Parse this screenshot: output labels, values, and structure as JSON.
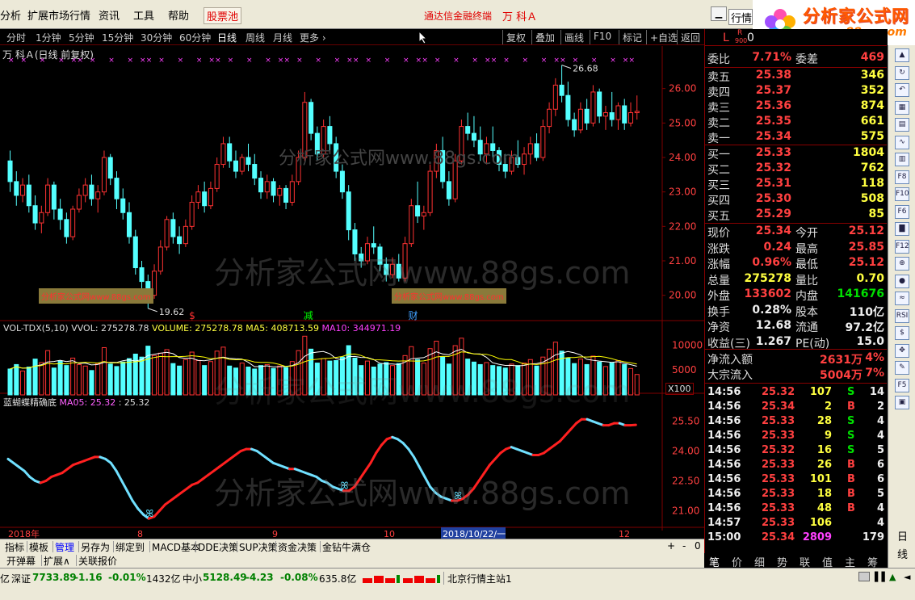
{
  "menubar": {
    "items": [
      "分析",
      "扩展市场行情",
      "资讯",
      "工具",
      "帮助"
    ],
    "stock_pool": "股票池",
    "app_title": "通达信金融终端",
    "stock_title": "万 科Ａ",
    "quote_select": "行情"
  },
  "logo": {
    "name": "分析家公式网",
    "url": "www.88gs.com"
  },
  "periods": {
    "items": [
      "分时",
      "1分钟",
      "5分钟",
      "15分钟",
      "30分钟",
      "60分钟",
      "日线",
      "周线",
      "月线",
      "更多 ›"
    ],
    "active": "日线"
  },
  "tools": [
    "复权",
    "叠加",
    "画线",
    "F10",
    "标记",
    "+自选",
    "返回"
  ],
  "chart": {
    "stock_line": "万 科Ａ(日线 前复权)",
    "price_ticks": [
      "26.00",
      "25.00",
      "24.00",
      "23.00",
      "22.00",
      "21.00",
      "20.00"
    ],
    "high_label": "26.68",
    "low_label": "19.62",
    "event_marks": [
      "$",
      "减",
      "财"
    ],
    "tag_left": "分析家公式网www.88gs.com",
    "tag_mid": "分析家公式网www.88gs.com",
    "vol_line": {
      "name": "VOL-TDX(5,10)",
      "vvol": "VVOL: 275278.78",
      "volume": "VOLUME: 275278.78",
      "ma5": "MA5: 408713.59",
      "ma10": "MA10: 344971.19"
    },
    "vol_ticks": [
      "10000",
      "5000"
    ],
    "vol_unit": "X100",
    "ind_line": {
      "name": "蓝蝴蝶精确底",
      "ma05": "MA05: 25.32",
      "val": ": 25.32"
    },
    "ind_ticks": [
      "25.50",
      "24.00",
      "22.50",
      "21.00"
    ],
    "date_axis": [
      "2018年",
      "8",
      "9",
      "10",
      "2018/10/22/一",
      "12"
    ],
    "watermark_text": "分析家公式网www.88gs.com",
    "watermark_small": "分析家公式网www.88gs.com"
  },
  "colors": {
    "up": "#ff3232",
    "down": "#54ffff",
    "ma5": "#ffffff",
    "ma10": "#ffff00",
    "grid": "#800000"
  },
  "chart_data": {
    "type": "candlestick",
    "ylim": [
      19.5,
      27.0
    ],
    "candles": [
      [
        23.9,
        24.2,
        23.0,
        23.3
      ],
      [
        23.3,
        23.6,
        22.6,
        22.9
      ],
      [
        22.9,
        23.4,
        22.7,
        23.2
      ],
      [
        23.2,
        23.5,
        22.4,
        22.6
      ],
      [
        22.6,
        22.9,
        21.9,
        22.1
      ],
      [
        22.1,
        22.6,
        21.8,
        22.4
      ],
      [
        22.4,
        23.4,
        22.3,
        23.2
      ],
      [
        23.2,
        23.3,
        22.2,
        22.5
      ],
      [
        22.5,
        22.8,
        21.9,
        22.2
      ],
      [
        22.2,
        22.4,
        21.5,
        21.7
      ],
      [
        21.7,
        22.6,
        21.6,
        22.5
      ],
      [
        22.5,
        23.1,
        22.4,
        22.9
      ],
      [
        22.9,
        23.4,
        22.7,
        23.2
      ],
      [
        23.2,
        23.5,
        22.6,
        22.8
      ],
      [
        22.8,
        23.2,
        22.4,
        23.0
      ],
      [
        23.0,
        24.2,
        22.9,
        24.0
      ],
      [
        24.0,
        24.1,
        23.2,
        23.4
      ],
      [
        23.4,
        23.6,
        22.5,
        22.8
      ],
      [
        22.8,
        23.1,
        22.2,
        22.4
      ],
      [
        22.4,
        22.7,
        21.5,
        21.7
      ],
      [
        21.7,
        21.9,
        20.6,
        20.8
      ],
      [
        20.8,
        21.0,
        20.1,
        20.4
      ],
      [
        20.4,
        20.6,
        19.62,
        20.0
      ],
      [
        20.0,
        20.9,
        19.9,
        20.7
      ],
      [
        20.7,
        21.6,
        20.6,
        21.4
      ],
      [
        21.4,
        22.3,
        21.3,
        22.2
      ],
      [
        22.2,
        22.4,
        21.5,
        21.7
      ],
      [
        21.7,
        22.0,
        21.2,
        21.5
      ],
      [
        21.5,
        22.2,
        21.4,
        22.0
      ],
      [
        22.0,
        22.9,
        21.9,
        22.7
      ],
      [
        22.7,
        23.2,
        22.5,
        23.0
      ],
      [
        23.0,
        23.3,
        22.4,
        22.6
      ],
      [
        22.6,
        23.3,
        22.5,
        23.1
      ],
      [
        23.1,
        24.0,
        23.0,
        23.8
      ],
      [
        23.8,
        24.6,
        23.7,
        24.4
      ],
      [
        24.4,
        24.6,
        23.7,
        23.9
      ],
      [
        23.9,
        24.2,
        23.4,
        23.6
      ],
      [
        23.6,
        24.1,
        23.5,
        24.0
      ],
      [
        24.0,
        24.4,
        23.6,
        23.8
      ],
      [
        23.8,
        24.1,
        23.2,
        23.4
      ],
      [
        23.4,
        23.6,
        22.8,
        23.0
      ],
      [
        23.0,
        23.5,
        22.8,
        23.3
      ],
      [
        23.3,
        23.4,
        22.7,
        22.9
      ],
      [
        22.9,
        23.2,
        22.6,
        23.1
      ],
      [
        23.1,
        23.2,
        22.5,
        22.7
      ],
      [
        22.7,
        23.5,
        22.6,
        23.3
      ],
      [
        23.3,
        24.2,
        23.2,
        24.0
      ],
      [
        24.0,
        25.9,
        23.9,
        25.6
      ],
      [
        25.6,
        25.7,
        24.5,
        24.7
      ],
      [
        24.7,
        24.9,
        23.9,
        24.1
      ],
      [
        24.1,
        25.1,
        24.0,
        24.9
      ],
      [
        24.9,
        25.2,
        24.2,
        24.4
      ],
      [
        24.4,
        24.6,
        23.4,
        23.6
      ],
      [
        23.6,
        23.8,
        22.8,
        23.0
      ],
      [
        23.0,
        23.2,
        21.6,
        21.9
      ],
      [
        21.9,
        22.1,
        21.0,
        21.2
      ],
      [
        21.2,
        21.4,
        20.8,
        21.0
      ],
      [
        21.0,
        21.7,
        20.9,
        21.5
      ],
      [
        21.5,
        22.0,
        21.2,
        21.4
      ],
      [
        21.4,
        21.5,
        20.7,
        20.9
      ],
      [
        20.9,
        21.1,
        20.4,
        20.6
      ],
      [
        20.6,
        21.1,
        20.5,
        20.9
      ],
      [
        20.9,
        21.2,
        20.4,
        20.5
      ],
      [
        20.5,
        21.7,
        20.4,
        21.5
      ],
      [
        21.5,
        22.8,
        21.4,
        22.6
      ],
      [
        22.6,
        23.3,
        22.1,
        22.3
      ],
      [
        22.3,
        22.6,
        21.9,
        22.4
      ],
      [
        22.4,
        23.8,
        22.3,
        23.6
      ],
      [
        23.6,
        24.4,
        23.4,
        24.2
      ],
      [
        24.2,
        24.6,
        23.1,
        23.3
      ],
      [
        23.3,
        23.6,
        22.6,
        22.8
      ],
      [
        22.8,
        24.1,
        22.7,
        23.9
      ],
      [
        23.9,
        25.1,
        23.8,
        24.9
      ],
      [
        24.9,
        25.3,
        24.5,
        24.7
      ],
      [
        24.7,
        25.2,
        24.3,
        24.5
      ],
      [
        24.5,
        24.9,
        23.9,
        24.1
      ],
      [
        24.1,
        24.6,
        23.8,
        24.4
      ],
      [
        24.4,
        24.9,
        24.0,
        24.2
      ],
      [
        24.2,
        24.3,
        23.6,
        23.8
      ],
      [
        23.8,
        24.1,
        23.4,
        23.6
      ],
      [
        23.6,
        24.2,
        23.5,
        24.0
      ],
      [
        24.0,
        24.5,
        23.7,
        23.8
      ],
      [
        23.8,
        24.3,
        23.5,
        24.1
      ],
      [
        24.1,
        24.6,
        23.8,
        24.4
      ],
      [
        24.4,
        24.7,
        23.9,
        24.0
      ],
      [
        24.0,
        25.1,
        23.9,
        24.9
      ],
      [
        24.9,
        25.6,
        24.7,
        25.4
      ],
      [
        25.4,
        26.3,
        25.2,
        26.1
      ],
      [
        26.1,
        26.68,
        25.6,
        25.8
      ],
      [
        25.8,
        26.2,
        24.9,
        25.1
      ],
      [
        25.1,
        25.3,
        24.6,
        24.8
      ],
      [
        24.8,
        25.6,
        24.7,
        25.4
      ],
      [
        25.4,
        25.7,
        24.8,
        25.0
      ],
      [
        25.0,
        26.1,
        24.9,
        25.9
      ],
      [
        25.9,
        26.0,
        25.0,
        25.2
      ],
      [
        25.2,
        25.5,
        24.8,
        25.3
      ],
      [
        25.3,
        25.9,
        24.9,
        25.1
      ],
      [
        25.1,
        25.6,
        24.8,
        25.5
      ],
      [
        25.5,
        25.7,
        24.8,
        25.0
      ],
      [
        25.0,
        25.6,
        24.9,
        25.3
      ],
      [
        25.3,
        25.8,
        25.1,
        25.34
      ]
    ],
    "volumes": [
      5200,
      6100,
      4800,
      5600,
      7200,
      6500,
      8900,
      5400,
      6800,
      5900,
      7400,
      6100,
      5800,
      4900,
      6300,
      9500,
      6200,
      5700,
      6600,
      7300,
      8200,
      7600,
      9800,
      7900,
      8400,
      9100,
      6300,
      5800,
      7100,
      8600,
      6900,
      5900,
      6700,
      8800,
      9600,
      5800,
      5400,
      6400,
      5600,
      5200,
      5900,
      6100,
      5300,
      5800,
      5500,
      6700,
      8900,
      11800,
      9200,
      6400,
      7300,
      6800,
      6900,
      7600,
      9900,
      7400,
      5900,
      6800,
      5600,
      6200,
      6500,
      5900,
      6300,
      7900,
      9700,
      7100,
      6400,
      9300,
      10800,
      7600,
      6200,
      9900,
      11400,
      7200,
      6600,
      6100,
      6500,
      5900,
      5700,
      5400,
      6200,
      5900,
      6400,
      7100,
      5800,
      7600,
      9200,
      10600,
      8800,
      7400,
      6300,
      7200,
      6100,
      7800,
      6600,
      5700,
      6400,
      6900,
      6100,
      5300,
      4100
    ],
    "indicator": [
      23.6,
      23.4,
      23.2,
      23.0,
      22.7,
      22.5,
      22.4,
      22.5,
      22.7,
      22.8,
      22.9,
      23.1,
      23.3,
      23.4,
      23.5,
      23.6,
      23.7,
      23.7,
      23.6,
      23.4,
      23.0,
      22.5,
      22.0,
      21.5,
      21.1,
      20.8,
      20.6,
      20.7,
      21.0,
      21.3,
      21.5,
      21.7,
      21.9,
      22.1,
      22.3,
      22.4,
      22.6,
      22.8,
      23.0,
      23.2,
      23.4,
      23.6,
      23.8,
      24.0,
      24.1,
      24.1,
      24.0,
      23.8,
      23.6,
      23.4,
      23.3,
      23.2,
      23.1,
      23.1,
      23.0,
      22.9,
      22.8,
      22.7,
      22.5,
      22.4,
      22.2,
      22.1,
      22.0,
      22.0,
      22.2,
      22.6,
      23.0,
      23.4,
      23.9,
      24.3,
      24.6,
      24.7,
      24.6,
      24.4,
      24.1,
      23.7,
      23.2,
      22.7,
      22.2,
      21.9,
      21.7,
      21.6,
      21.5,
      21.5,
      21.6,
      21.8,
      22.1,
      22.5,
      22.9,
      23.3,
      23.6,
      23.9,
      24.1,
      24.2,
      24.1,
      24.0,
      23.9,
      23.8,
      23.8,
      23.9,
      24.1,
      24.3,
      24.5,
      24.8,
      25.1,
      25.4,
      25.6,
      25.6,
      25.5,
      25.4,
      25.3,
      25.3,
      25.4,
      25.4,
      25.3,
      25.3,
      25.32
    ],
    "indicator_ylim": [
      20.2,
      26.3
    ]
  },
  "quote": {
    "code_flags": [
      "L",
      "R",
      "900",
      "0"
    ],
    "weibi": {
      "l1": "委比",
      "v1": "7.71%",
      "l2": "委差",
      "v2": "469"
    },
    "asks": [
      {
        "label": "卖五",
        "price": "25.38",
        "vol": "346"
      },
      {
        "label": "卖四",
        "price": "25.37",
        "vol": "352"
      },
      {
        "label": "卖三",
        "price": "25.36",
        "vol": "874"
      },
      {
        "label": "卖二",
        "price": "25.35",
        "vol": "661"
      },
      {
        "label": "卖一",
        "price": "25.34",
        "vol": "575"
      }
    ],
    "bids": [
      {
        "label": "买一",
        "price": "25.33",
        "vol": "1804"
      },
      {
        "label": "买二",
        "price": "25.32",
        "vol": "762"
      },
      {
        "label": "买三",
        "price": "25.31",
        "vol": "118"
      },
      {
        "label": "买四",
        "price": "25.30",
        "vol": "508"
      },
      {
        "label": "买五",
        "price": "25.29",
        "vol": "85"
      }
    ],
    "stats": [
      {
        "l1": "现价",
        "v1": "25.34",
        "c1": "red",
        "l2": "今开",
        "v2": "25.12",
        "c2": "red"
      },
      {
        "l1": "涨跌",
        "v1": "0.24",
        "c1": "red",
        "l2": "最高",
        "v2": "25.85",
        "c2": "red"
      },
      {
        "l1": "涨幅",
        "v1": "0.96%",
        "c1": "red",
        "l2": "最低",
        "v2": "25.12",
        "c2": "red"
      },
      {
        "l1": "总量",
        "v1": "275278",
        "c1": "yel",
        "l2": "量比",
        "v2": "0.70",
        "c2": "yel"
      },
      {
        "l1": "外盘",
        "v1": "133602",
        "c1": "red",
        "l2": "内盘",
        "v2": "141676",
        "c2": "green"
      },
      {
        "l1": "换手",
        "v1": "0.28%",
        "c1": "wht",
        "l2": "股本",
        "v2": "110亿",
        "c2": "wht"
      },
      {
        "l1": "净资",
        "v1": "12.68",
        "c1": "wht",
        "l2": "流通",
        "v2": "97.2亿",
        "c2": "wht"
      },
      {
        "l1": "收益(三)",
        "v1": "1.267",
        "c1": "wht",
        "l2": "PE(动)",
        "v2": "15.0",
        "c2": "wht"
      }
    ],
    "flows": [
      {
        "label": "净流入额",
        "value": "2631万",
        "pct": "4%"
      },
      {
        "label": "大宗流入",
        "value": "5004万",
        "pct": "7%"
      }
    ],
    "ticks": [
      {
        "time": "14:56",
        "price": "25.32",
        "vol": "107",
        "side": "S",
        "n": "14"
      },
      {
        "time": "14:56",
        "price": "25.34",
        "vol": "2",
        "side": "B",
        "n": "2"
      },
      {
        "time": "14:56",
        "price": "25.33",
        "vol": "28",
        "side": "S",
        "n": "4"
      },
      {
        "time": "14:56",
        "price": "25.33",
        "vol": "9",
        "side": "S",
        "n": "4"
      },
      {
        "time": "14:56",
        "price": "25.32",
        "vol": "16",
        "side": "S",
        "n": "5"
      },
      {
        "time": "14:56",
        "price": "25.33",
        "vol": "26",
        "side": "B",
        "n": "6"
      },
      {
        "time": "14:56",
        "price": "25.33",
        "vol": "101",
        "side": "B",
        "n": "6"
      },
      {
        "time": "14:56",
        "price": "25.33",
        "vol": "18",
        "side": "B",
        "n": "5"
      },
      {
        "time": "14:56",
        "price": "25.33",
        "vol": "48",
        "side": "B",
        "n": "4"
      },
      {
        "time": "14:57",
        "price": "25.33",
        "vol": "106",
        "side": "",
        "n": "4"
      },
      {
        "time": "15:00",
        "price": "25.34",
        "vol": "2809",
        "side": "",
        "n": "179"
      }
    ],
    "bottom_tabs": [
      "笔",
      "价",
      "细",
      "势",
      "联",
      "值",
      "主",
      "筹"
    ]
  },
  "sidebar": {
    "icons": [
      "arrow-up-icon",
      "refresh-icon",
      "back-icon",
      "table-icon",
      "grid-icon",
      "line-chart-icon",
      "kline-icon",
      "f8-icon",
      "f10-icon",
      "f6-icon",
      "bar-chart-icon",
      "f12-icon",
      "zoom-icon",
      "ball-icon",
      "wave-icon",
      "rsi-icon",
      "dollar-icon",
      "move-icon",
      "pen-icon",
      "f5-icon",
      "scroll-icon"
    ],
    "icon_texts": [
      "▲",
      "↻",
      "↶",
      "▦",
      "▤",
      "∿",
      "▥",
      "F8",
      "F10",
      "F6",
      "▇",
      "F12",
      "⊕",
      "●",
      "≈",
      "RSI",
      "$",
      "✥",
      "✎",
      "F5",
      "▣"
    ],
    "chars": [
      "日",
      "线"
    ]
  },
  "tabs": {
    "row1": [
      "指标",
      "模板",
      "管理",
      "另存为",
      "绑定到",
      "MACD基本",
      "DDE决策",
      "SUP决策",
      "资金决策",
      "金钻牛满仓"
    ],
    "active": "管理",
    "row2": [
      "开弹幕",
      "扩展∧",
      "关联报价"
    ],
    "scroll": [
      "+",
      "-",
      "0"
    ]
  },
  "status": {
    "yi": "亿",
    "sz_label": "深证",
    "sz_value": "7733.89",
    "sz_change": "-1.16",
    "sz_pct": "-0.01%",
    "sz_amt": "1432亿",
    "zx_label": "中小",
    "zx_value": "5128.49",
    "zx_change": "-4.23",
    "zx_pct": "-0.08%",
    "zx_amt": "635.8亿",
    "server": "北京行情主站1"
  }
}
